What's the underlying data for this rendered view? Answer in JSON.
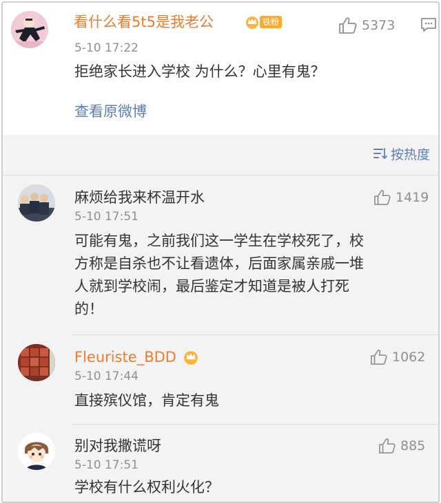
{
  "main_comment": {
    "username": "看什么看5t5是我老公",
    "fan_badge": "铁粉",
    "time": "5-10 17:22",
    "likes": "5373",
    "content": "拒绝家长进入学校 为什么？心里有鬼？",
    "view_original": "查看原微博"
  },
  "sort": {
    "label": "按热度"
  },
  "replies": [
    {
      "username": "麻烦给我来杯温开水",
      "time": "5-10 17:51",
      "likes": "1419",
      "content_lines": [
        "可能有鬼，之前我们这一学生在学校死了，校",
        "方称是自杀也不让看遗体，后面家属亲戚一堆",
        "人就到学校闹，最后鉴定才知道是被人打死",
        "的！"
      ]
    },
    {
      "username": "Fleuriste_BDD",
      "time": "5-10 17:44",
      "likes": "1062",
      "content_lines": [
        "直接殡仪馆，肯定有鬼"
      ]
    },
    {
      "username": "别对我撒谎呀",
      "time": "5-10 17:51",
      "likes": "885",
      "content_lines": [
        "学校有什么权利火化？"
      ]
    }
  ],
  "colors": {
    "vip_username": "#f07b2b",
    "link": "#5b7fb4",
    "muted": "#8f8f8f",
    "reply_bg": "#f3f3f3"
  }
}
